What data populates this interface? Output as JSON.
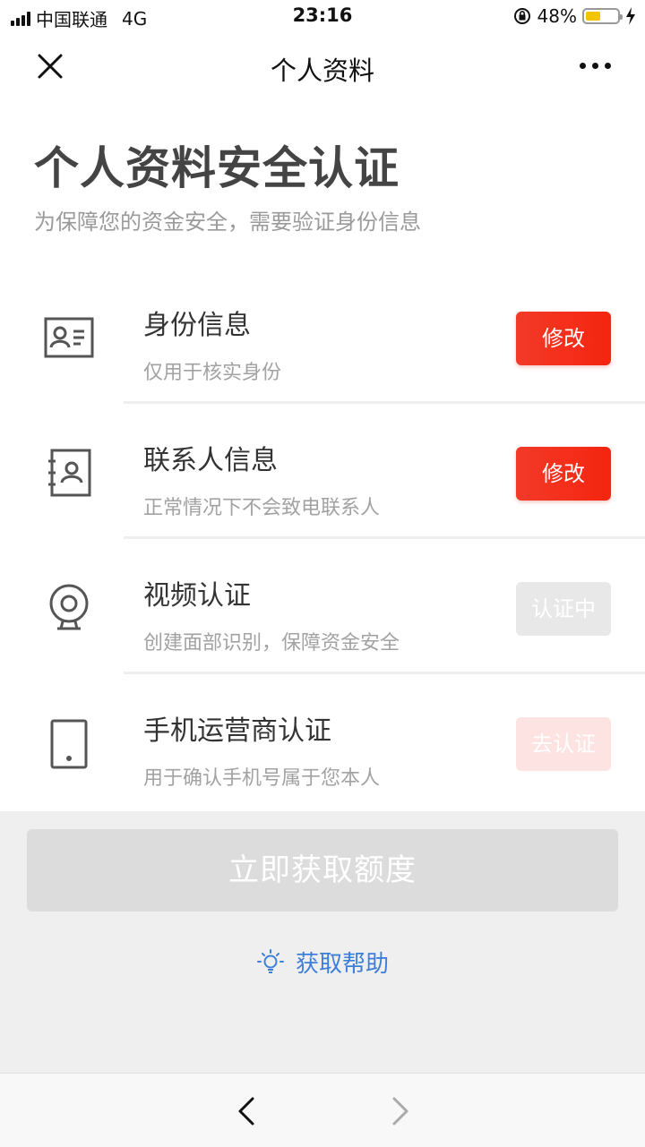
{
  "status_bar": {
    "carrier": "中国联通",
    "network": "4G",
    "time": "23:16",
    "battery_percent_text": "48%",
    "battery_level": 0.48,
    "battery_color": "#f2c500"
  },
  "nav": {
    "title": "个人资料",
    "close_icon": "close-icon",
    "more_icon": "more-icon"
  },
  "header": {
    "title": "个人资料安全认证",
    "subtitle": "为保障您的资金安全，需要验证身份信息"
  },
  "items": [
    {
      "icon": "id-card-icon",
      "title": "身份信息",
      "desc": "仅用于核实身份",
      "button": "修改",
      "button_state": "active"
    },
    {
      "icon": "contacts-book-icon",
      "title": "联系人信息",
      "desc": "正常情况下不会致电联系人",
      "button": "修改",
      "button_state": "active"
    },
    {
      "icon": "webcam-icon",
      "title": "视频认证",
      "desc": "创建面部识别，保障资金安全",
      "button": "认证中",
      "button_state": "pending"
    },
    {
      "icon": "phone-icon",
      "title": "手机运营商认证",
      "desc": "用于确认手机号属于您本人",
      "button": "去认证",
      "button_state": "disabled"
    }
  ],
  "main_button": {
    "label": "立即获取额度",
    "state": "disabled"
  },
  "help": {
    "label": "获取帮助",
    "icon": "lightbulb-icon",
    "color": "#3d7fd8"
  },
  "colors": {
    "accent_red": "#f23a28",
    "link_blue": "#3d7fd8"
  },
  "browser_nav": {
    "back_icon": "chevron-left-icon",
    "forward_icon": "chevron-right-icon"
  }
}
